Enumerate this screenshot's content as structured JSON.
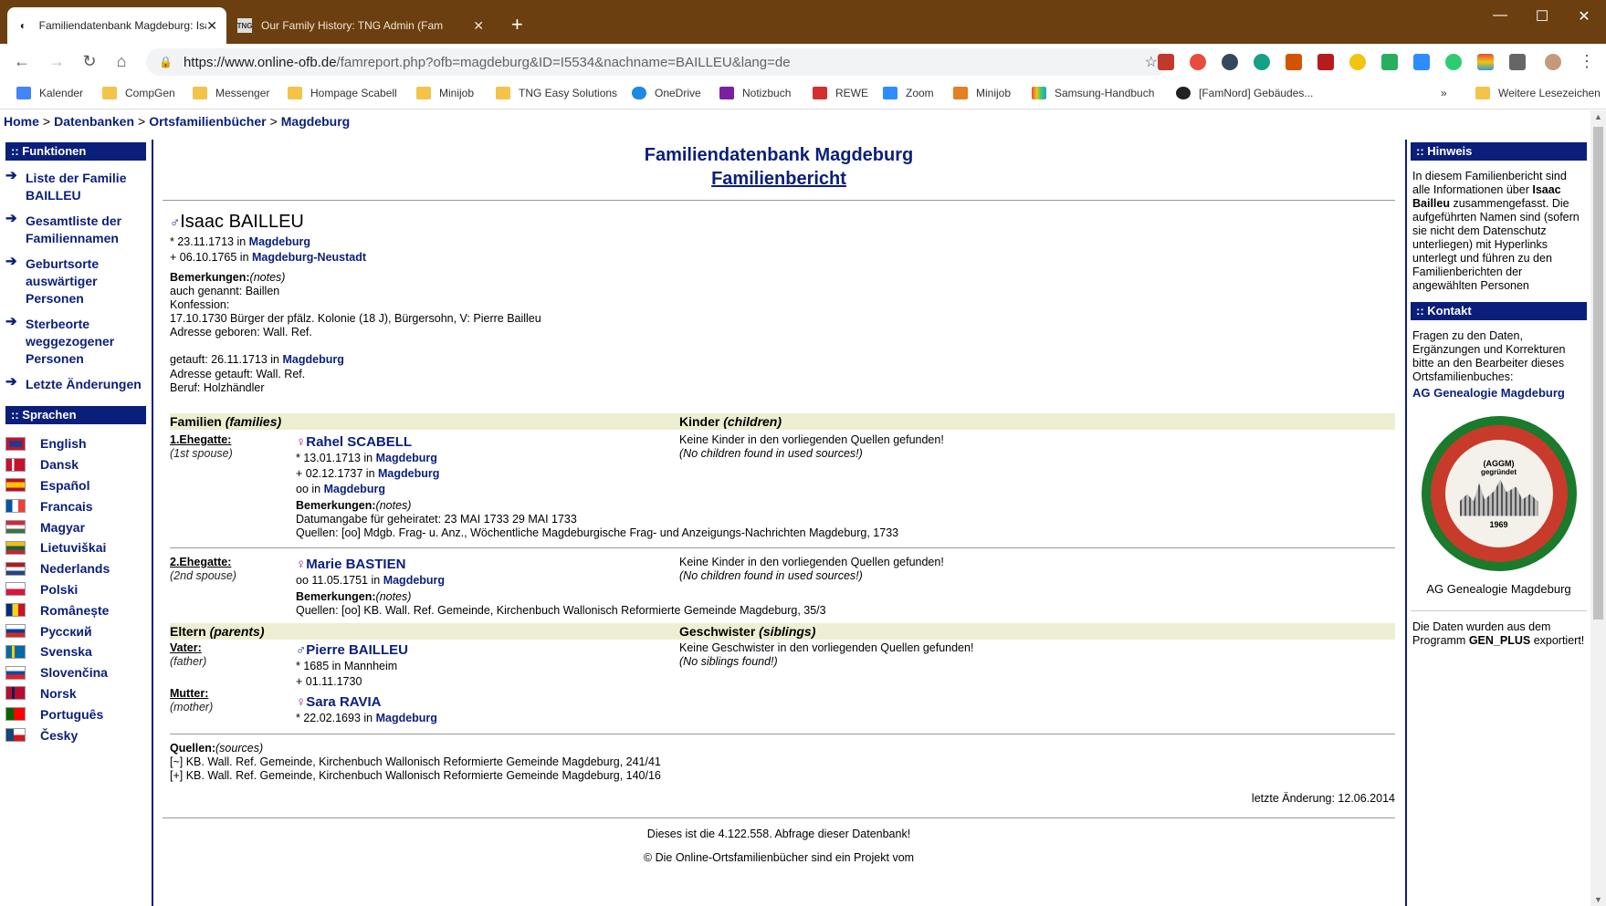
{
  "tabs": [
    {
      "title": "Familiendatenbank Magdeburg: Isaac",
      "active": true
    },
    {
      "title": "Our Family History: TNG Admin (Fam",
      "active": false
    }
  ],
  "address": {
    "host": "https://www.online-ofb.de",
    "path": "/famreport.php?ofb=magdeburg&ID=I5534&nachname=BAILLEU&lang=de"
  },
  "bookmarks": [
    "Kalender",
    "CompGen",
    "Messenger",
    "Hompage Scabell",
    "Minijob",
    "TNG Easy Solutions",
    "OneDrive",
    "Notizbuch",
    "REWE",
    "Zoom",
    "Minijob",
    "Samsung-Handbuch",
    "[FamNord] Gebäudes...",
    "Weitere Lesezeichen"
  ],
  "breadcrumb": [
    "Home",
    "Datenbanken",
    "Ortsfamilienbücher",
    "Magdeburg"
  ],
  "left": {
    "functions_title": ":: Funktionen",
    "functions": [
      "Liste der Familie BAILLEU",
      "Gesamtliste der Familiennamen",
      "Geburtsorte auswärtiger Personen",
      "Sterbeorte weggezogener Personen",
      "Letzte Änderungen"
    ],
    "languages_title": ":: Sprachen",
    "languages": [
      "English",
      "Dansk",
      "Español",
      "Francais",
      "Magyar",
      "Lietuviškai",
      "Nederlands",
      "Polski",
      "Românește",
      "Русский",
      "Svenska",
      "Slovenčina",
      "Norsk",
      "Português",
      "Česky"
    ]
  },
  "right": {
    "hint_title": ":: Hinweis",
    "hint_a": "In diesem Familienbericht sind alle Informationen über ",
    "hint_name": "Isaac Bailleu",
    "hint_b": " zusammengefasst. Die aufgeführten Namen sind (sofern sie nicht dem Datenschutz unterliegen) mit Hyperlinks unterlegt und führen zu den Familienberichten der angewählten Personen",
    "contact_title": ":: Kontakt",
    "contact_text": "Fragen zu den Daten, Ergänzungen und Korrekturen bitte an den Bearbeiter dieses Ortsfamilienbuches:",
    "contact_link": "AG Genealogie Magdeburg",
    "seal_top": "(AGGM)",
    "seal_founded": "gegründet",
    "seal_year": "1969",
    "seal_caption": "AG Genealogie Magdeburg",
    "export_a": "Die Daten wurden aus dem Programm ",
    "export_prog": "GEN_PLUS",
    "export_b": " exportiert!"
  },
  "main": {
    "title": "Familiendatenbank Magdeburg",
    "subtitle": "Familienbericht",
    "person_name": "Isaac BAILLEU",
    "birth": {
      "prefix": "* 23.11.1713 in ",
      "place": "Magdeburg"
    },
    "death": {
      "prefix": "+ 06.10.1765 in ",
      "place": "Magdeburg-Neustadt"
    },
    "notes_label": "Bemerkungen:",
    "notes_en": "(notes)",
    "notes": [
      "auch genannt: Baillen",
      "Konfession:",
      "17.10.1730 Bürger der pfälz. Kolonie (18 J), Bürgersohn, V: Pierre Bailleu",
      "Adresse geboren: Wall. Ref."
    ],
    "baptism": {
      "prefix": "getauft: 26.11.1713 in ",
      "place": "Magdeburg"
    },
    "notes2": [
      "Adresse getauft: Wall. Ref.",
      "Beruf: Holzhändler"
    ],
    "families_head": "Familien",
    "families_en": "(families)",
    "children_head": "Kinder",
    "children_en": "(children)",
    "spouses": [
      {
        "role": "1.Ehegatte:",
        "role_en": "(1st spouse)",
        "name": "Rahel SCABELL",
        "birth_prefix": "* 13.01.1713 in ",
        "birth_place": "Magdeburg",
        "death_prefix": "+ 02.12.1737 in ",
        "death_place": "Magdeburg",
        "marriage_prefix": "oo in ",
        "marriage_place": "Magdeburg",
        "notes_label": "Bemerkungen:",
        "notes_en": "(notes)",
        "notes": [
          "Datumangabe für geheiratet: 23 MAI 1733 29 MAI 1733",
          "Quellen: [oo] Mdgb. Frag- u. Anz., Wöchentliche Magdeburgische Frag- und Anzeigungs-Nachrichten Magdeburg, 1733"
        ],
        "children": "Keine Kinder in den vorliegenden Quellen gefunden!",
        "children_en": "(No children found in used sources!)"
      },
      {
        "role": "2.Ehegatte:",
        "role_en": "(2nd spouse)",
        "name": "Marie BASTIEN",
        "marriage_prefix": "oo 11.05.1751 in ",
        "marriage_place": "Magdeburg",
        "notes_label": "Bemerkungen:",
        "notes_en": "(notes)",
        "notes": [
          "Quellen: [oo] KB. Wall. Ref. Gemeinde, Kirchenbuch Wallonisch Reformierte Gemeinde Magdeburg, 35/3"
        ],
        "children": "Keine Kinder in den vorliegenden Quellen gefunden!",
        "children_en": "(No children found in used sources!)"
      }
    ],
    "parents_head": "Eltern",
    "parents_en": "(parents)",
    "siblings_head": "Geschwister",
    "siblings_en": "(siblings)",
    "father": {
      "role": "Vater:",
      "role_en": "(father)",
      "name": "Pierre BAILLEU",
      "birth": "* 1685 in Mannheim",
      "death": "+ 01.11.1730"
    },
    "mother": {
      "role": "Mutter:",
      "role_en": "(mother)",
      "name": "Sara RAVIA",
      "birth_prefix": "* 22.02.1693 in ",
      "birth_place": "Magdeburg"
    },
    "siblings": "Keine Geschwister in den vorliegenden Quellen gefunden!",
    "siblings_en2": "(No siblings found!)",
    "sources_label": "Quellen:",
    "sources_en": "(sources)",
    "sources": [
      "[~] KB. Wall. Ref. Gemeinde, Kirchenbuch Wallonisch Reformierte Gemeinde Magdeburg, 241/41",
      "[+] KB. Wall. Ref. Gemeinde, Kirchenbuch Wallonisch Reformierte Gemeinde Magdeburg, 140/16"
    ],
    "last_change": "letzte Änderung: 12.06.2014",
    "counter": "Dieses ist die 4.122.558. Abfrage dieser Datenbank!",
    "copyright": "© Die Online-Ortsfamilienbücher sind ein Projekt vom"
  }
}
